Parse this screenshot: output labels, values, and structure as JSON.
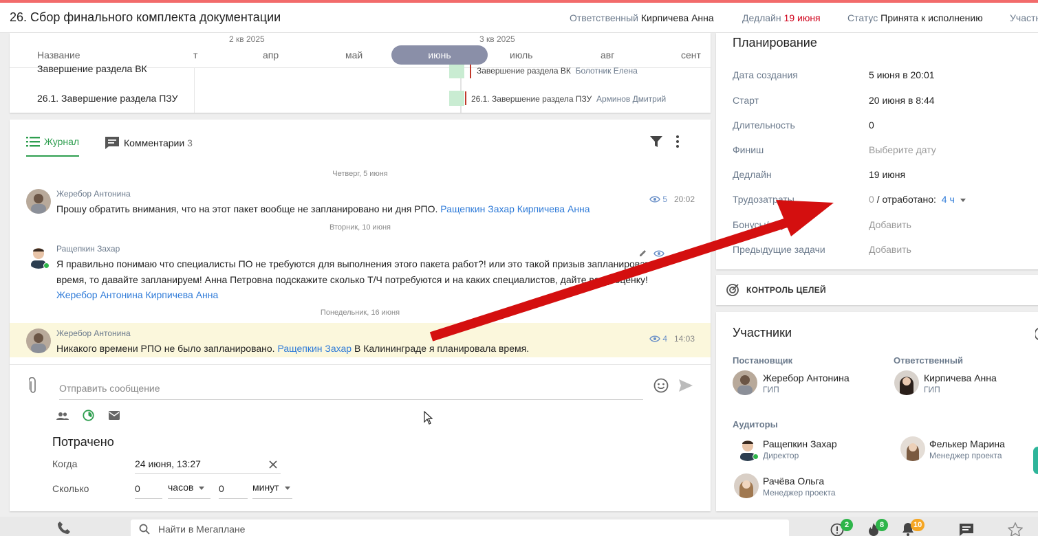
{
  "task": {
    "title": "26. Сбор финального комплекта документации",
    "responsible_label": "Ответственный",
    "responsible_value": "Кирпичева Анна",
    "deadline_label": "Дедлайн",
    "deadline_value": "19 июня",
    "status_label": "Статус",
    "status_value": "Принята к исполнению",
    "participants_label": "Участн"
  },
  "gantt": {
    "name_header": "Название",
    "quarters": [
      "2 кв 2025",
      "3 кв 2025"
    ],
    "months": [
      "т",
      "апр",
      "май",
      "июнь",
      "июль",
      "авг",
      "сент"
    ],
    "active_month": "июнь",
    "rows": [
      {
        "name": "Завершение раздела ВК",
        "bar_label": "Завершение раздела ВК",
        "person": "Болотник Елена"
      },
      {
        "name": "26.1. Завершение раздела ПЗУ",
        "bar_label": "26.1. Завершение раздела ПЗУ",
        "person": "Арминов Дмитрий"
      }
    ]
  },
  "journal": {
    "tab_journal": "Журнал",
    "tab_comments": "Комментарии",
    "comments_count": "3",
    "date_1": "Четверг, 5 июня",
    "date_2": "Вторник, 10 июня",
    "date_3": "Понедельник, 16 июня",
    "messages": [
      {
        "author": "Жеребор Антонина",
        "text": "Прошу обратить внимания, что на этот пакет вообще не запланировано ни дня РПО.",
        "mentions": "Ращепкин Захар Кирпичева Анна",
        "views": "5",
        "time": "20:02"
      },
      {
        "author": "Ращепкин Захар",
        "text": "Я правильно понимаю что специалисты ПО не требуются для выполнения этого пакета работ?!  или это такой призыв запланировать время, то давайте запланируем!    Анна Петровна подскажите сколько Т/Ч потребуются и на каких специалистов, дайте вашу оценку!",
        "mentions": "Жеребор Антонина Кирпичева Анна"
      },
      {
        "author": "Жеребор Антонина",
        "text_before": "Никакого времени РПО не было запланировано.",
        "mention": "Ращепкин Захар",
        "text_after": "В Калининграде я планировала время.",
        "views": "4",
        "time": "14:03"
      }
    ],
    "composer_placeholder": "Отправить сообщение",
    "spent_title": "Потрачено",
    "when_label": "Когда",
    "when_value": "24 июня, 13:27",
    "howmuch_label": "Сколько",
    "hours_value": "0",
    "hours_unit": "часов",
    "minutes_value": "0",
    "minutes_unit": "минут"
  },
  "planning": {
    "title": "Планирование",
    "rows": [
      {
        "label": "Дата создания",
        "value": "5 июня в 20:01"
      },
      {
        "label": "Старт",
        "value": "20 июня в 8:44"
      },
      {
        "label": "Длительность",
        "value": "0"
      },
      {
        "label": "Финиш",
        "value": "Выберите дату"
      },
      {
        "label": "Дедлайн",
        "value": "19 июня"
      },
      {
        "label": "Трудозатраты",
        "value": "0"
      },
      {
        "label": "Бонусы/штраф",
        "value": "Добавить"
      },
      {
        "label": "Предыдущие задачи",
        "value": "Добавить"
      }
    ],
    "worked_label": "/ отработано:",
    "worked_value": "4 ч"
  },
  "goals": {
    "label": "КОНТРОЛЬ ЦЕЛЕЙ"
  },
  "participants": {
    "title": "Участники",
    "setter_label": "Постановщик",
    "setter_name": "Жеребор Антонина",
    "setter_role": "ГИП",
    "responsible_label": "Ответственный",
    "responsible_name": "Кирпичева Анна",
    "responsible_role": "ГИП",
    "auditors_label": "Аудиторы",
    "auditors": [
      {
        "name": "Ращепкин Захар",
        "role": "Директор"
      },
      {
        "name": "Фелькер Марина",
        "role": "Менеджер проекта"
      },
      {
        "name": "Рачёва Ольга",
        "role": "Менеджер проекта"
      }
    ]
  },
  "bottom": {
    "search_placeholder": "Найти в Мегаплане",
    "badge_alerts": "2",
    "badge_fire": "8",
    "badge_bell": "10"
  },
  "colors": {
    "accent_green": "#2e9e4f",
    "link_blue": "#2f7bd8",
    "deadline_red": "#d0021b",
    "annotation_arrow": "#d40f0f",
    "highlight_row": "#fbf7dc"
  }
}
